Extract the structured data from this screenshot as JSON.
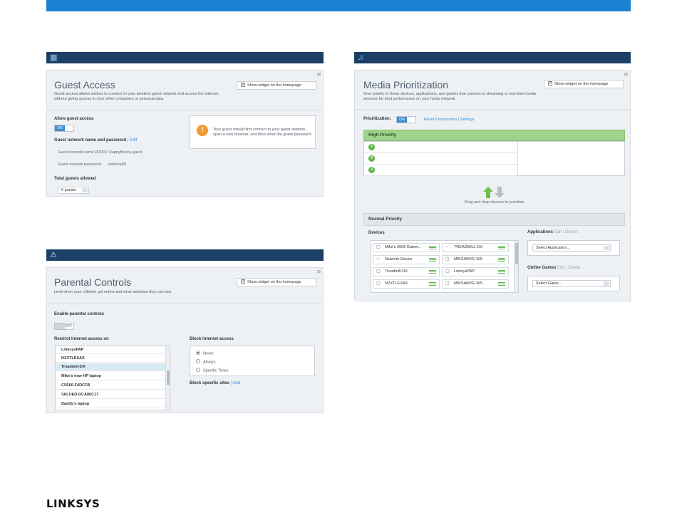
{
  "brand": {
    "logo_text": "LINKSYS",
    "accent": "#1a82d0",
    "header_color": "#1b3f66"
  },
  "guest": {
    "icon": "guest-access-icon",
    "title": "Guest Access",
    "description": "Guest access allows visitors to connect to your wireless guest network and access the Internet, without giving access to your other computers or personal data.",
    "widget_label": "Show widget on the homepage",
    "allow_label": "Allow guest access",
    "toggle_state": "ON",
    "network_label": "Guest network name and password",
    "edit_label": "Edit",
    "ssid_label": "Guest network name (SSID):",
    "ssid_value": "HappyBunny-guest",
    "password_label": "Guest network password:",
    "password_value": "rasberry88",
    "total_label": "Total guests allowed",
    "total_value": "5 guests",
    "notice": "Your guest should first connect to your guest network, open a web browser, and then enter the guest password."
  },
  "parental": {
    "icon": "warning-icon",
    "title": "Parental Controls",
    "description": "Limit when your children get online and what websites they can see.",
    "widget_label": "Show widget on the homepage",
    "enable_label": "Enable parental controls",
    "toggle_state": "OFF",
    "restrict_label": "Restrict Internet access on",
    "devices": [
      "LinksysPAP",
      "NZXTLEXAS",
      "Treadmill-DX",
      "Mike's new HP laptop",
      "C5S00-F4DCFB",
      "VALUED-DCA80C17",
      "Daddy's laptop"
    ],
    "selected_device": "Treadmill-DX",
    "block_label": "Block Internet access",
    "options": [
      "Never",
      "Always",
      "Specific Times"
    ],
    "selected_option": "Never",
    "sites_label": "Block specific sites",
    "add_label": "Add"
  },
  "media": {
    "icon": "media-prioritization-icon",
    "title": "Media Prioritization",
    "description": "Give priority to those devices, applications, and games that connect to streaming or real-time media services for best performance on your home network.",
    "widget_label": "Show widget on the homepage",
    "prioritization_label": "Prioritization:",
    "toggle_state": "ON",
    "reset_label": "Reset Prioritization",
    "settings_label": "Settings",
    "high_priority_label": "High Priority",
    "slots": [
      "1",
      "2",
      "3"
    ],
    "drag_hint": "Drag and drop devices to prioritize",
    "normal_priority_label": "Normal Priority",
    "devices_label": "Devices",
    "devices": [
      "Mike's 2008 Gatew...",
      "TREADMILL-DX",
      "Network Device",
      "MIKSAWYE-WS",
      "Treadmill-DX",
      "LinksysPAP",
      "NZXTLEXAS",
      "MIKSAWYE-WS"
    ],
    "applications_label": "Applications",
    "edit_label": "Edit",
    "delete_label": "Delete",
    "select_app": "Select Application...",
    "games_label": "Online Games",
    "select_game": "Select Game..."
  }
}
